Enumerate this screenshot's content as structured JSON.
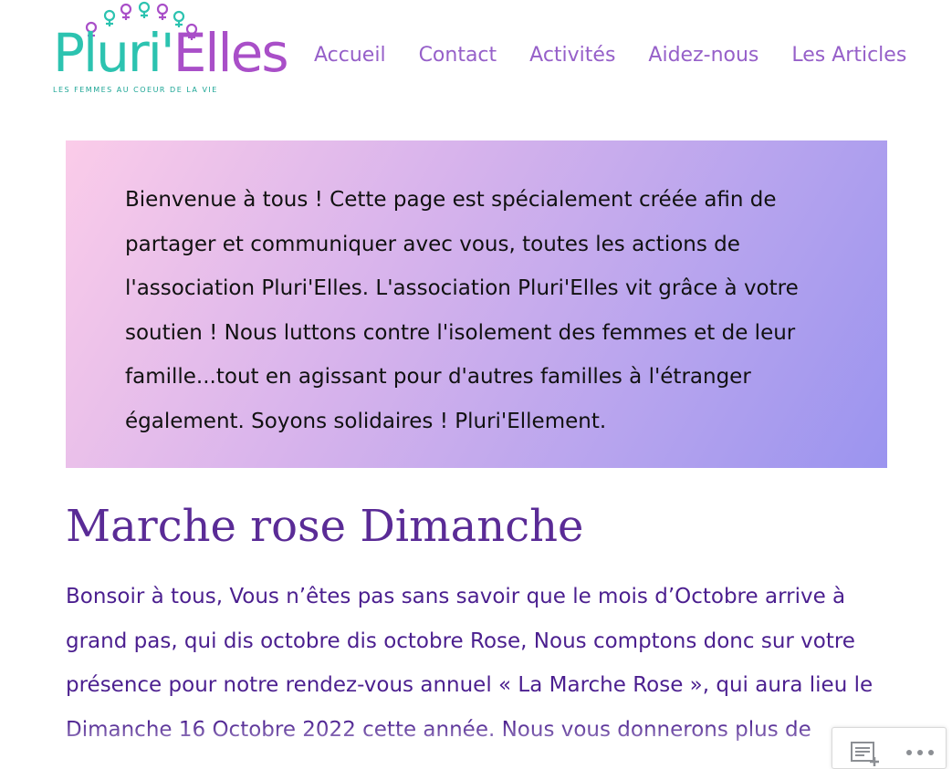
{
  "logo": {
    "name_part1": "Pluri'",
    "name_part2": "Elles",
    "tagline": "LES FEMMES AU COEUR DE LA VIE",
    "colors": {
      "teal": "#2cc3b0",
      "purple": "#a94fc8"
    }
  },
  "nav": {
    "items": [
      {
        "label": "Accueil"
      },
      {
        "label": "Contact"
      },
      {
        "label": "Activités"
      },
      {
        "label": "Aidez-nous"
      },
      {
        "label": "Les Articles"
      }
    ],
    "color": "#9660c9"
  },
  "welcome": {
    "text": "Bienvenue à tous ! Cette page est spécialement créée afin de partager et communiquer avec vous, toutes les actions de l'association Pluri'Elles. L'association Pluri'Elles vit grâce à votre soutien ! Nous luttons contre l'isolement des femmes et de leur famille...tout en agissant pour d'autres familles à l'étranger également. Soyons solidaires ! Pluri'Ellement."
  },
  "post": {
    "title": "Marche rose Dimanche",
    "body": "Bonsoir à tous, Vous n’êtes pas sans savoir que le mois d’Octobre arrive à grand pas, qui dis octobre dis octobre Rose, Nous comptons donc sur votre présence pour notre rendez-vous annuel « La Marche Rose », qui aura lieu le Dimanche 16 Octobre 2022 cette année. Nous vous donnerons plus de",
    "title_color": "#5a2b96",
    "body_color": "#4b1f8f"
  },
  "action_bar": {
    "icons": [
      "reader-icon",
      "more-icon"
    ]
  }
}
